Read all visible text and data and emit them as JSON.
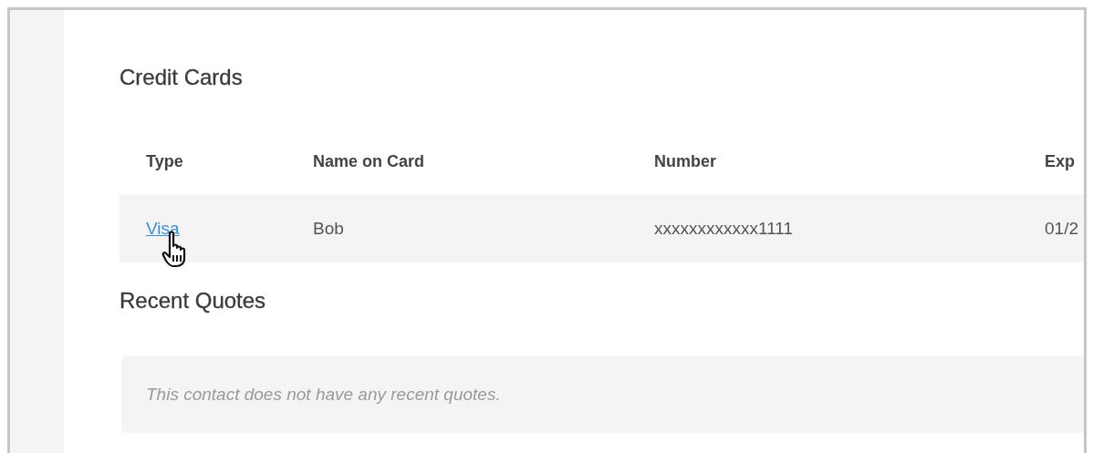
{
  "credit_cards": {
    "title": "Credit Cards",
    "table": {
      "columns": [
        "Type",
        "Name on Card",
        "Number",
        "Exp"
      ],
      "rows": [
        {
          "cells": [
            {
              "kind": "link",
              "text": "Visa"
            },
            {
              "kind": "text",
              "text": "Bob"
            },
            {
              "kind": "text",
              "text": "xxxxxxxxxxxx1111"
            },
            {
              "kind": "text",
              "text": "01/2"
            }
          ]
        }
      ]
    }
  },
  "recent_quotes": {
    "title": "Recent Quotes",
    "empty_message": "This contact does not have any recent quotes."
  }
}
